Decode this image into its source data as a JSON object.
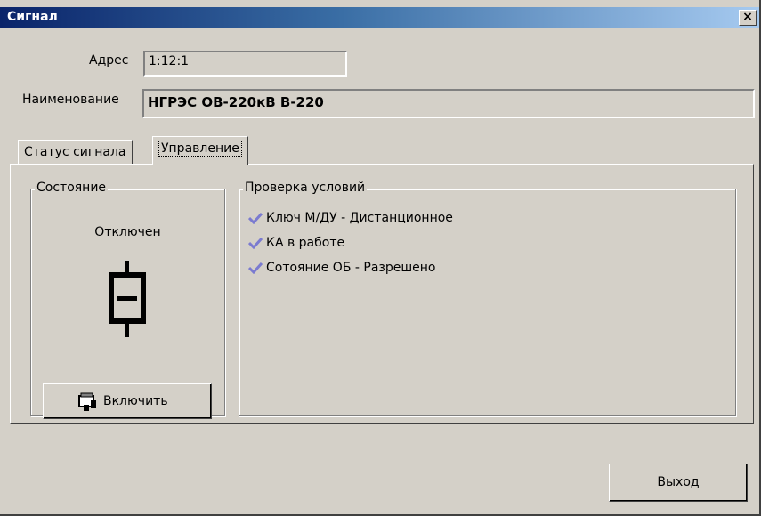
{
  "window": {
    "title": "Сигнал",
    "close_glyph": "×"
  },
  "fields": {
    "address_label": "Адрес",
    "address_value": "1:12:1",
    "name_label": "Наименование",
    "name_value": "НГРЭС ОВ-220кВ В-220"
  },
  "tabs": [
    {
      "label": "Статус сигнала"
    },
    {
      "label": "Управление"
    }
  ],
  "state_group": {
    "legend": "Состояние",
    "status_text": "Отключен",
    "icon": "breaker-open-icon",
    "switch_button_label": "Включить"
  },
  "conditions_group": {
    "legend": "Проверка условий",
    "items": [
      {
        "label": "Ключ М/ДУ - Дистанционное"
      },
      {
        "label": "КА в работе"
      },
      {
        "label": "Сотояние ОБ - Разрешено"
      }
    ],
    "check_icon": "check-icon",
    "check_color": "#7b7bd0"
  },
  "footer": {
    "exit_label": "Выход"
  }
}
